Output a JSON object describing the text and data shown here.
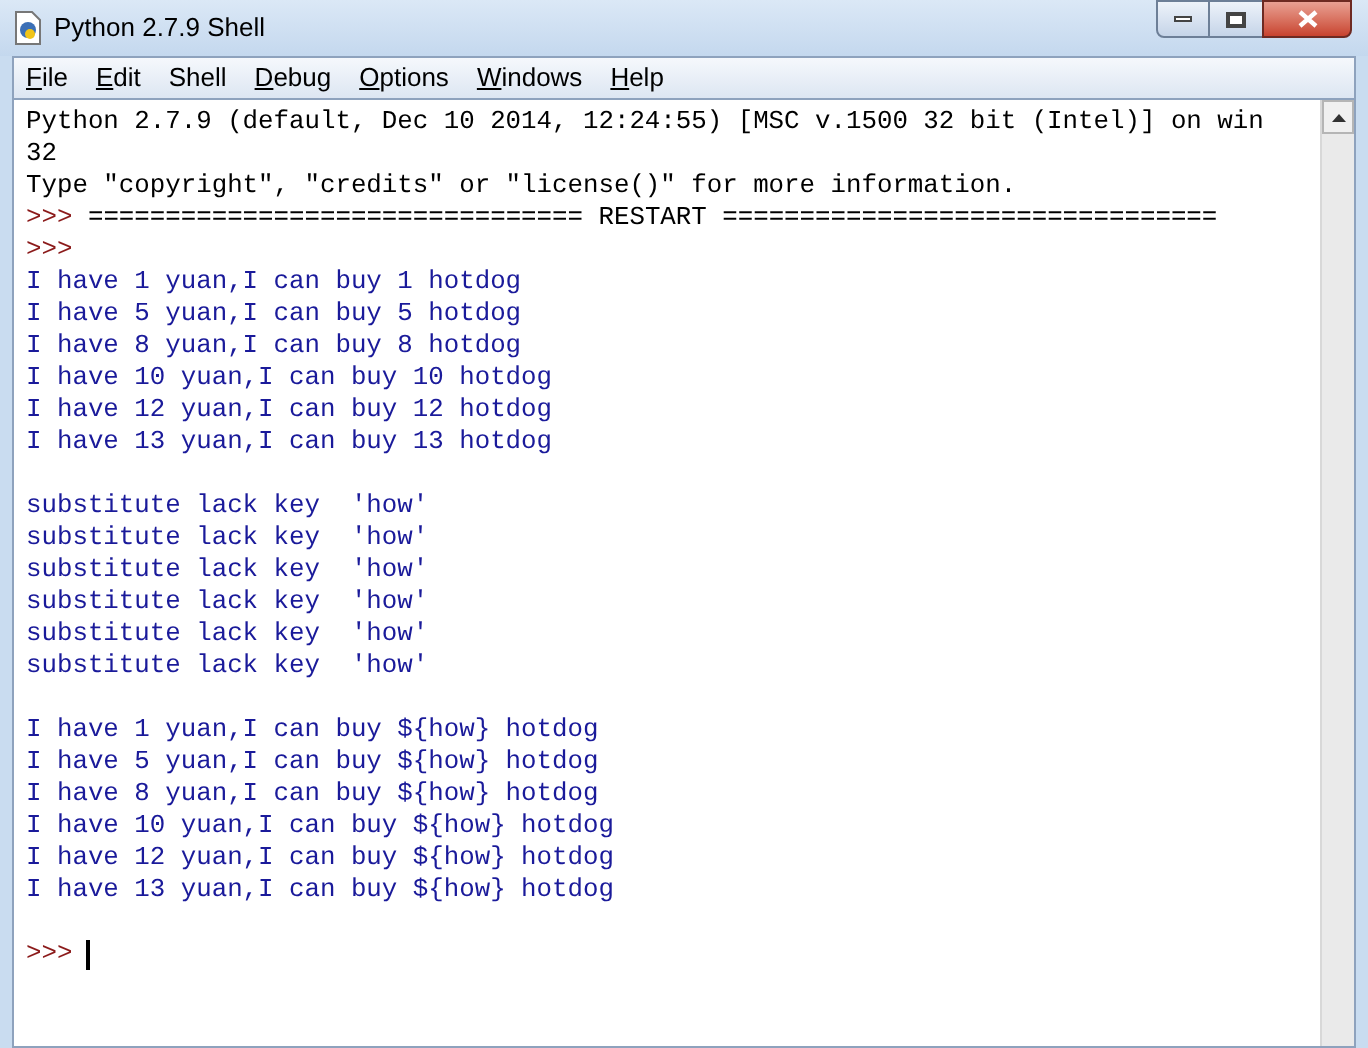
{
  "window": {
    "title": "Python 2.7.9 Shell"
  },
  "menu": [
    {
      "label": "File",
      "underline_first": true
    },
    {
      "label": "Edit",
      "underline_first": true
    },
    {
      "label": "Shell",
      "underline_first": false
    },
    {
      "label": "Debug",
      "underline_first": true
    },
    {
      "label": "Options",
      "underline_first": true
    },
    {
      "label": "Windows",
      "underline_first": true
    },
    {
      "label": "Help",
      "underline_first": true
    }
  ],
  "lines": [
    {
      "kind": "output",
      "text": "Python 2.7.9 (default, Dec 10 2014, 12:24:55) [MSC v.1500 32 bit (Intel)] on win"
    },
    {
      "kind": "output",
      "text": "32"
    },
    {
      "kind": "output",
      "text": "Type \"copyright\", \"credits\" or \"license()\" for more information."
    },
    {
      "kind": "prompt",
      "prompt": ">>>",
      "text": "================================ RESTART ================================"
    },
    {
      "kind": "prompt",
      "prompt": ">>>"
    },
    {
      "kind": "stdout",
      "text": "I have 1 yuan,I can buy 1 hotdog"
    },
    {
      "kind": "stdout",
      "text": "I have 5 yuan,I can buy 5 hotdog"
    },
    {
      "kind": "stdout",
      "text": "I have 8 yuan,I can buy 8 hotdog"
    },
    {
      "kind": "stdout",
      "text": "I have 10 yuan,I can buy 10 hotdog"
    },
    {
      "kind": "stdout",
      "text": "I have 12 yuan,I can buy 12 hotdog"
    },
    {
      "kind": "stdout",
      "text": "I have 13 yuan,I can buy 13 hotdog"
    },
    {
      "kind": "blank"
    },
    {
      "kind": "stdout",
      "text": "substitute lack key  'how'"
    },
    {
      "kind": "stdout",
      "text": "substitute lack key  'how'"
    },
    {
      "kind": "stdout",
      "text": "substitute lack key  'how'"
    },
    {
      "kind": "stdout",
      "text": "substitute lack key  'how'"
    },
    {
      "kind": "stdout",
      "text": "substitute lack key  'how'"
    },
    {
      "kind": "stdout",
      "text": "substitute lack key  'how'"
    },
    {
      "kind": "blank"
    },
    {
      "kind": "stdout",
      "text": "I have 1 yuan,I can buy ${how} hotdog"
    },
    {
      "kind": "stdout",
      "text": "I have 5 yuan,I can buy ${how} hotdog"
    },
    {
      "kind": "stdout",
      "text": "I have 8 yuan,I can buy ${how} hotdog"
    },
    {
      "kind": "stdout",
      "text": "I have 10 yuan,I can buy ${how} hotdog"
    },
    {
      "kind": "stdout",
      "text": "I have 12 yuan,I can buy ${how} hotdog"
    },
    {
      "kind": "stdout",
      "text": "I have 13 yuan,I can buy ${how} hotdog"
    },
    {
      "kind": "blank"
    },
    {
      "kind": "prompt",
      "prompt": ">>>",
      "cursor": true
    }
  ]
}
